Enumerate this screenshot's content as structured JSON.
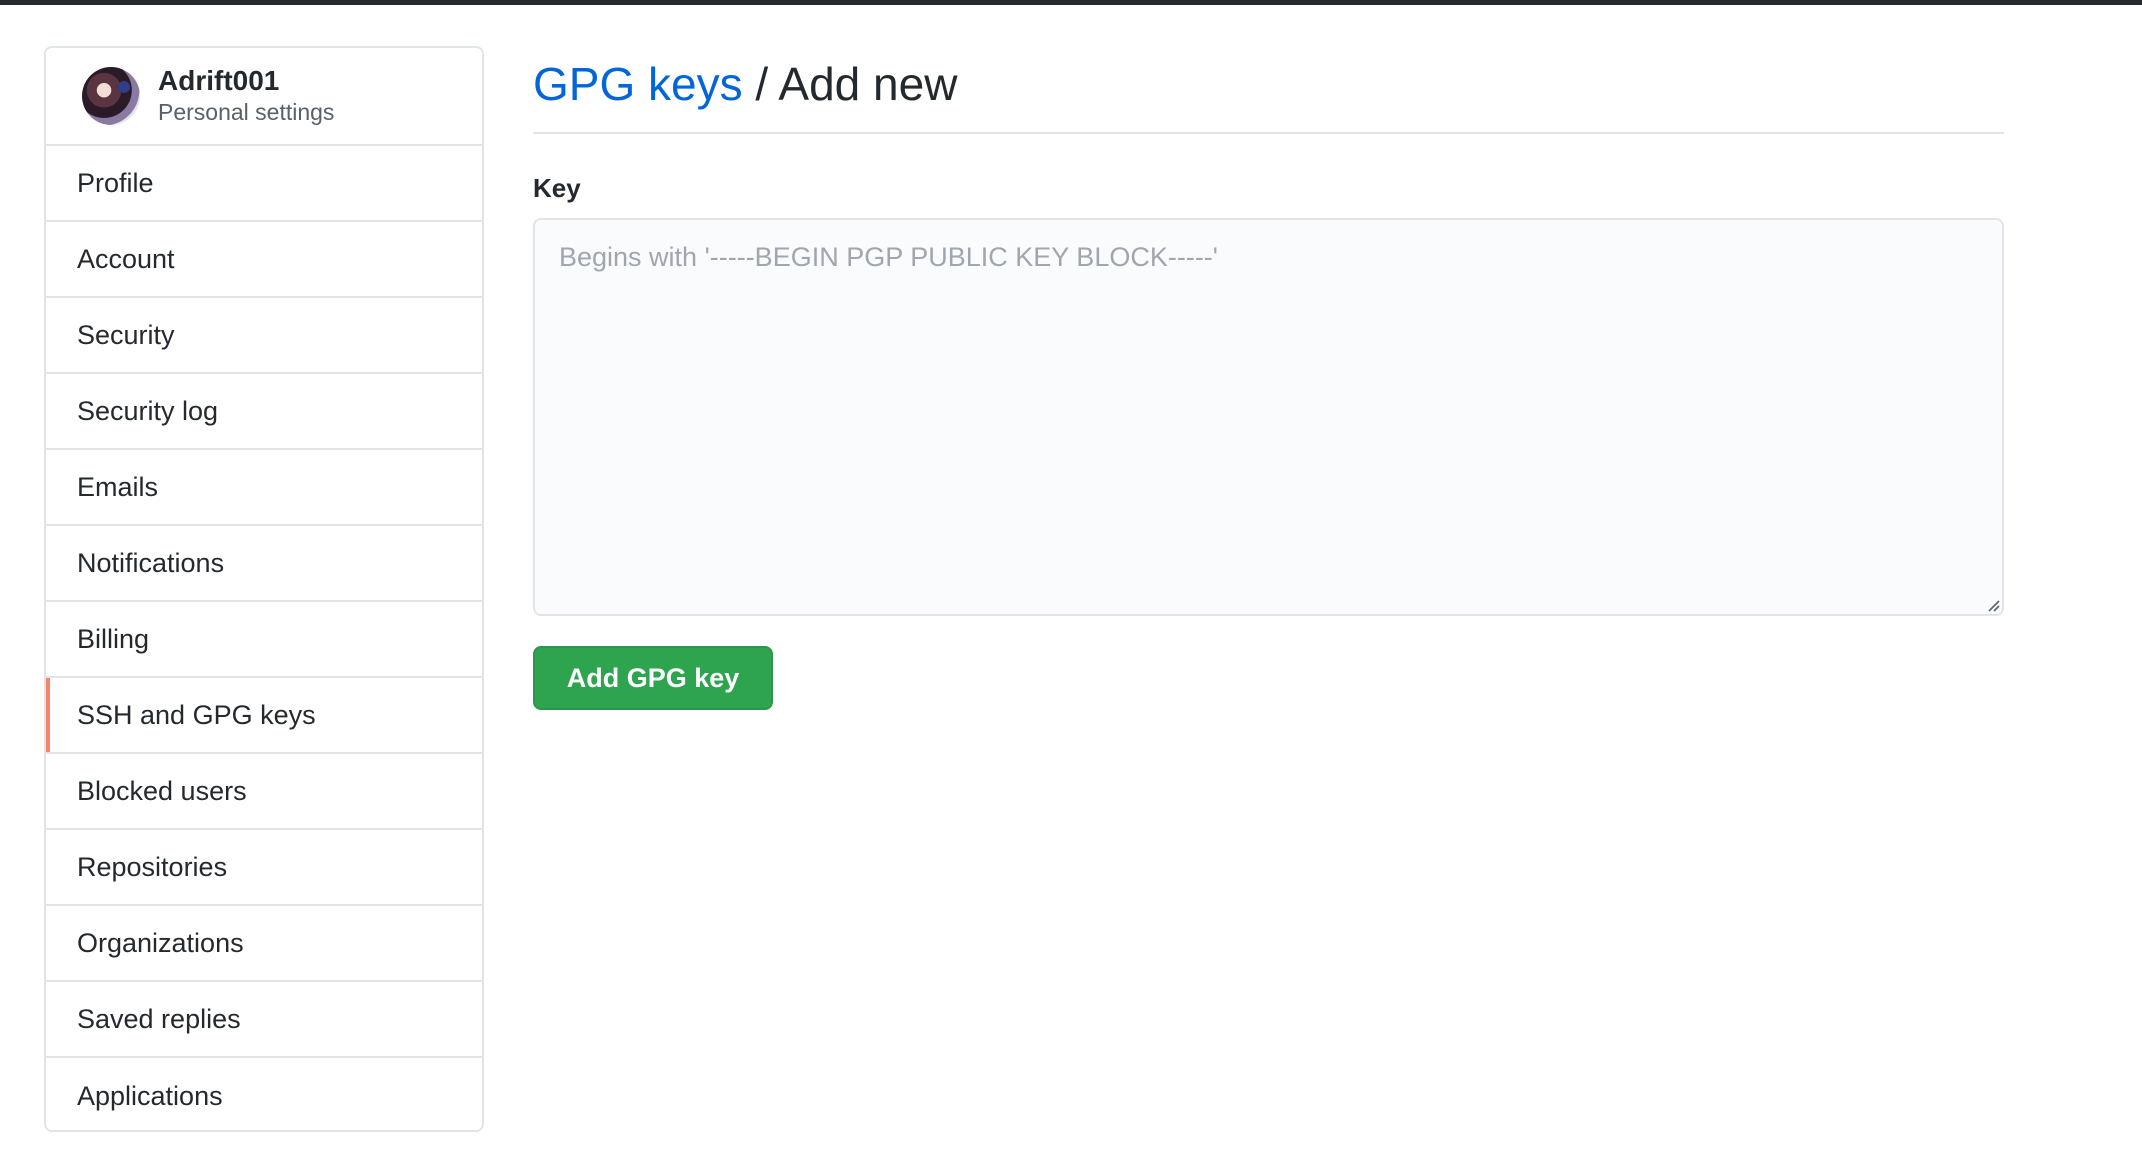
{
  "user": {
    "name": "Adrift001",
    "subtitle": "Personal settings"
  },
  "sidebar": {
    "items": [
      {
        "label": "Profile",
        "selected": false
      },
      {
        "label": "Account",
        "selected": false
      },
      {
        "label": "Security",
        "selected": false
      },
      {
        "label": "Security log",
        "selected": false
      },
      {
        "label": "Emails",
        "selected": false
      },
      {
        "label": "Notifications",
        "selected": false
      },
      {
        "label": "Billing",
        "selected": false
      },
      {
        "label": "SSH and GPG keys",
        "selected": true
      },
      {
        "label": "Blocked users",
        "selected": false
      },
      {
        "label": "Repositories",
        "selected": false
      },
      {
        "label": "Organizations",
        "selected": false
      },
      {
        "label": "Saved replies",
        "selected": false
      },
      {
        "label": "Applications",
        "selected": false
      }
    ]
  },
  "header": {
    "link_text": "GPG keys",
    "separator": " / ",
    "rest": "Add new"
  },
  "form": {
    "key_label": "Key",
    "key_value": "",
    "key_placeholder": "Begins with '-----BEGIN PGP PUBLIC KEY BLOCK-----'",
    "submit_label": "Add GPG key"
  },
  "colors": {
    "accent_link": "#0366d6",
    "selected_indicator": "#f9826c",
    "button_green": "#2ea44f",
    "top_bar": "#24292e"
  },
  "icons": {
    "avatar": "user-avatar",
    "resize": "resize-handle-icon"
  }
}
